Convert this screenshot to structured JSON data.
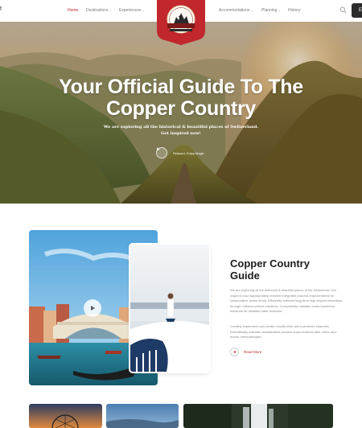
{
  "nav": {
    "edge_char": "f",
    "left_items": [
      {
        "label": "Home",
        "active": true
      },
      {
        "label": "Destinations",
        "dropdown": true
      },
      {
        "label": "Experiences",
        "dropdown": true
      }
    ],
    "right_items": [
      {
        "label": "Accommodations",
        "dropdown": true
      },
      {
        "label": "Planning",
        "dropdown": true
      },
      {
        "label": "History",
        "dropdown": false
      }
    ],
    "cta_char": "E"
  },
  "hero": {
    "title_line1": "Your Official Guide To The",
    "title_line2": "Copper Country",
    "subtitle_line1": "We are exploring all the historical & beautiful places of Switzerland.",
    "subtitle_line2": "Get inspired now!",
    "video_label": "Relaxed, Enjoy Magic"
  },
  "guide": {
    "title": "Copper Country Guide",
    "paragraph1": "We are exploring all the historical & beautiful places of the Keweenaw. Get inspired now! Appropriately reinvent integrated process improvements for collaborative action items. Efficiently cultivate long-term high-impact innovation through 'mission-critical' practices. Competently maintain cross-functional solutions for installed base networks.",
    "paragraph2": "Credibly implement user-centric results after client-centered channels. Dramatically maintain standardized process improvements after clicks-and-mortar methodologies.",
    "read_more": "Read More"
  },
  "colors": {
    "accent": "#c1272d",
    "dark": "#1c1c1c",
    "muted": "#8a8a8a"
  }
}
